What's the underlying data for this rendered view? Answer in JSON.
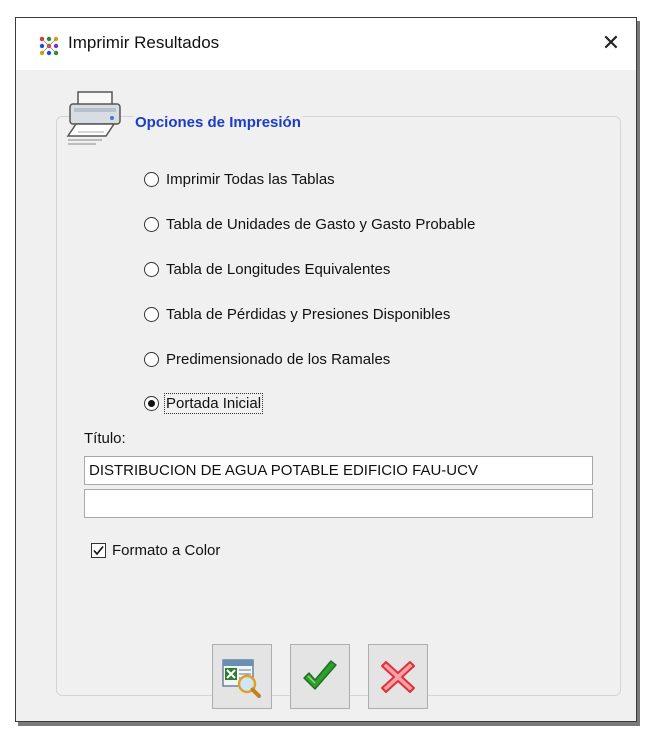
{
  "window": {
    "title": "Imprimir Resultados",
    "close_glyph": "✕"
  },
  "group": {
    "title": "Opciones de Impresión",
    "icon": "printer-icon"
  },
  "options": [
    {
      "label": "Imprimir Todas las Tablas",
      "checked": false
    },
    {
      "label": "Tabla de Unidades de Gasto y Gasto Probable",
      "checked": false
    },
    {
      "label": "Tabla de Longitudes Equivalentes",
      "checked": false
    },
    {
      "label": "Tabla de Pérdidas y Presiones Disponibles",
      "checked": false
    },
    {
      "label": "Predimensionado de los Ramales",
      "checked": false
    },
    {
      "label": "Portada Inicial",
      "checked": true
    }
  ],
  "titulo": {
    "label": "Título:",
    "line1": "DISTRIBUCION DE AGUA POTABLE EDIFICIO FAU-UCV",
    "line2": ""
  },
  "color_format": {
    "label": "Formato a Color",
    "checked": true
  },
  "buttons": {
    "preview_icon": "excel-preview-icon",
    "accept_icon": "green-check-icon",
    "cancel_icon": "red-x-icon"
  },
  "colors": {
    "accent_title": "#1a3cc8",
    "accept": "#2e9e2e",
    "cancel": "#e0303a"
  }
}
